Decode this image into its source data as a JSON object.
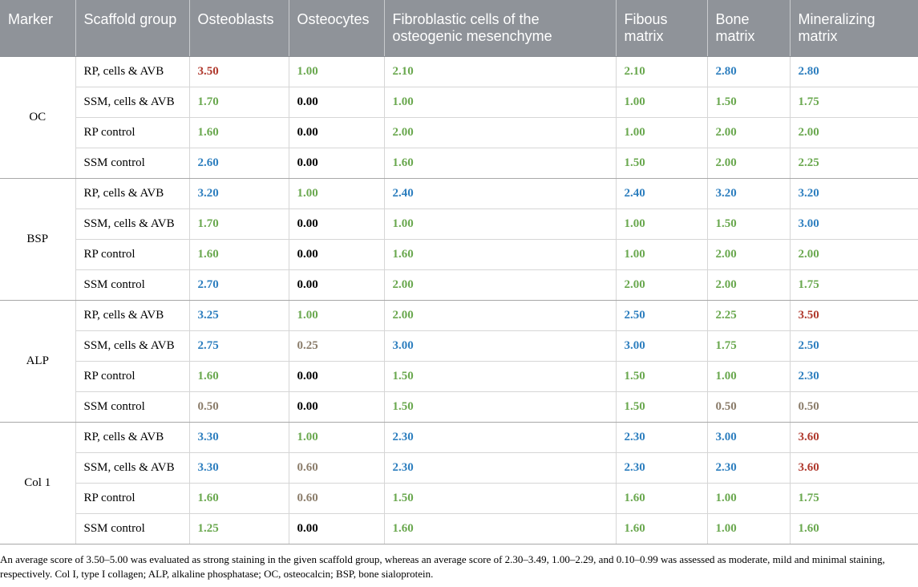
{
  "colors": {
    "header_bg": "#8f9399",
    "header_text": "#ffffff",
    "strong": "#b03a2e",
    "moderate": "#2e7fbf",
    "mild": "#6aa84f",
    "minimal": "#8b7d6b",
    "none": "#000000"
  },
  "table": {
    "headers": [
      "Marker",
      "Scaffold group",
      "Osteoblasts",
      "Osteocytes",
      "Fibroblastic cells of the osteogenic mesenchyme",
      "Fibous matrix",
      "Bone matrix",
      "Mineralizing matrix"
    ],
    "groups": [
      {
        "marker": "OC",
        "rows": [
          {
            "scaffold": "RP, cells & AVB",
            "values": [
              "3.50",
              "1.00",
              "2.10",
              "2.10",
              "2.80",
              "2.80"
            ]
          },
          {
            "scaffold": "SSM, cells & AVB",
            "values": [
              "1.70",
              "0.00",
              "1.00",
              "1.00",
              "1.50",
              "1.75"
            ]
          },
          {
            "scaffold": "RP control",
            "values": [
              "1.60",
              "0.00",
              "2.00",
              "1.00",
              "2.00",
              "2.00"
            ]
          },
          {
            "scaffold": "SSM control",
            "values": [
              "2.60",
              "0.00",
              "1.60",
              "1.50",
              "2.00",
              "2.25"
            ]
          }
        ]
      },
      {
        "marker": "BSP",
        "rows": [
          {
            "scaffold": "RP, cells & AVB",
            "values": [
              "3.20",
              "1.00",
              "2.40",
              "2.40",
              "3.20",
              "3.20"
            ]
          },
          {
            "scaffold": "SSM, cells & AVB",
            "values": [
              "1.70",
              "0.00",
              "1.00",
              "1.00",
              "1.50",
              "3.00"
            ]
          },
          {
            "scaffold": "RP control",
            "values": [
              "1.60",
              "0.00",
              "1.60",
              "1.00",
              "2.00",
              "2.00"
            ]
          },
          {
            "scaffold": "SSM control",
            "values": [
              "2.70",
              "0.00",
              "2.00",
              "2.00",
              "2.00",
              "1.75"
            ]
          }
        ]
      },
      {
        "marker": "ALP",
        "rows": [
          {
            "scaffold": "RP, cells & AVB",
            "values": [
              "3.25",
              "1.00",
              "2.00",
              "2.50",
              "2.25",
              "3.50"
            ]
          },
          {
            "scaffold": "SSM, cells & AVB",
            "values": [
              "2.75",
              "0.25",
              "3.00",
              "3.00",
              "1.75",
              "2.50"
            ]
          },
          {
            "scaffold": "RP control",
            "values": [
              "1.60",
              "0.00",
              "1.50",
              "1.50",
              "1.00",
              "2.30"
            ]
          },
          {
            "scaffold": "SSM control",
            "values": [
              "0.50",
              "0.00",
              "1.50",
              "1.50",
              "0.50",
              "0.50"
            ]
          }
        ]
      },
      {
        "marker": "Col 1",
        "rows": [
          {
            "scaffold": "RP, cells & AVB",
            "values": [
              "3.30",
              "1.00",
              "2.30",
              "2.30",
              "3.00",
              "3.60"
            ]
          },
          {
            "scaffold": "SSM, cells & AVB",
            "values": [
              "3.30",
              "0.60",
              "2.30",
              "2.30",
              "2.30",
              "3.60"
            ]
          },
          {
            "scaffold": "RP control",
            "values": [
              "1.60",
              "0.60",
              "1.50",
              "1.60",
              "1.00",
              "1.75"
            ]
          },
          {
            "scaffold": "SSM control",
            "values": [
              "1.25",
              "0.00",
              "1.60",
              "1.60",
              "1.00",
              "1.60"
            ]
          }
        ]
      }
    ]
  },
  "footnote": "An average score of 3.50–5.00 was evaluated as strong staining in the given scaffold group, whereas an average score of 2.30–3.49, 1.00–2.29, and 0.10–0.99 was assessed as moderate, mild and minimal staining, respectively. Col I, type I collagen; ALP, alkaline phosphatase; OC, osteocalcin; BSP, bone sialoprotein."
}
